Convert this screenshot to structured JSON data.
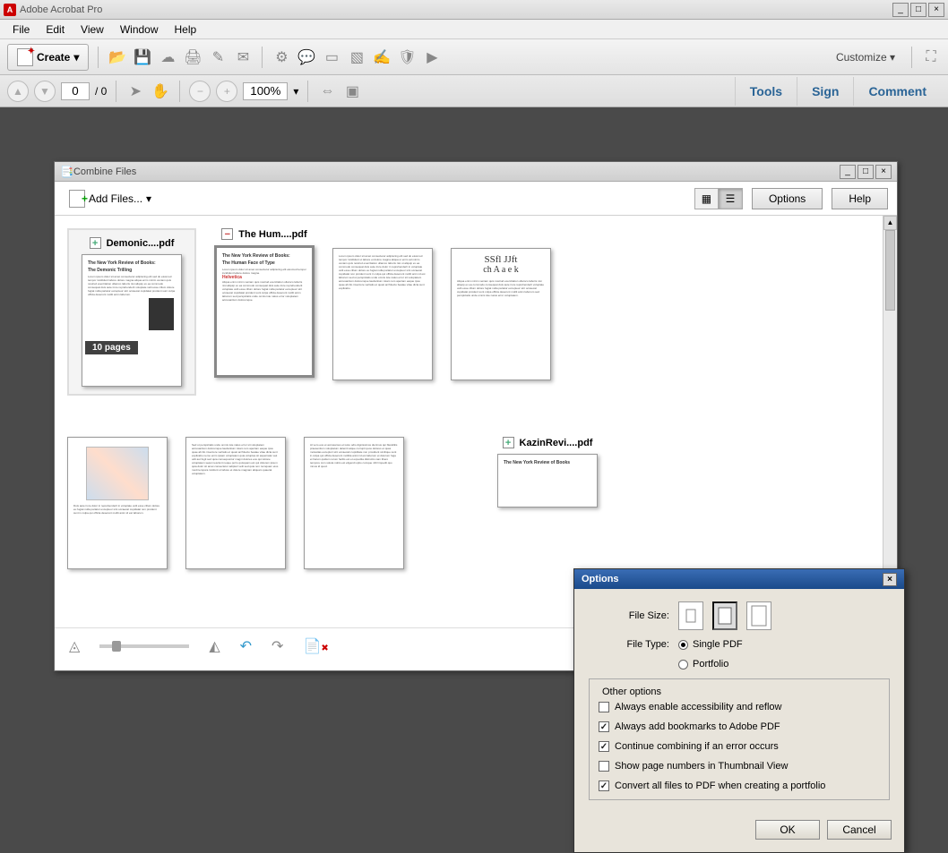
{
  "app": {
    "title": "Adobe Acrobat Pro"
  },
  "menu": {
    "file": "File",
    "edit": "Edit",
    "view": "View",
    "window": "Window",
    "help": "Help"
  },
  "toolbar": {
    "create": "Create",
    "customize": "Customize"
  },
  "nav": {
    "page_value": "0",
    "page_total": "/ 0",
    "zoom": "100%"
  },
  "side": {
    "tools": "Tools",
    "sign": "Sign",
    "comment": "Comment"
  },
  "combine": {
    "title": "Combine Files",
    "add_files": "Add Files...",
    "options": "Options",
    "help": "Help",
    "docs": {
      "d1_name": "Demonic....pdf",
      "d1_badge": "10 pages",
      "d1_heading": "The New York Review of Books:",
      "d1_subheading": "The Demonic Trilling",
      "d2_name": "The Hum....pdf",
      "d2_heading": "The New York Review of Books:",
      "d2_subheading": "The Human Face of Type",
      "hel_logo": "Helvetica",
      "fancy_r1": "SSfl JJft",
      "fancy_r2": "ch A a e k",
      "d3_name": "KazinRevi....pdf"
    }
  },
  "optdlg": {
    "title": "Options",
    "file_size": "File Size:",
    "file_type": "File Type:",
    "type_single": "Single PDF",
    "type_portfolio": "Portfolio",
    "other_legend": "Other options",
    "o1": "Always enable accessibility and reflow",
    "o2": "Always add bookmarks to Adobe PDF",
    "o3": "Continue combining if an error occurs",
    "o4": "Show page numbers in Thumbnail View",
    "o5": "Convert all files to PDF when creating a portfolio",
    "ok": "OK",
    "cancel": "Cancel"
  }
}
